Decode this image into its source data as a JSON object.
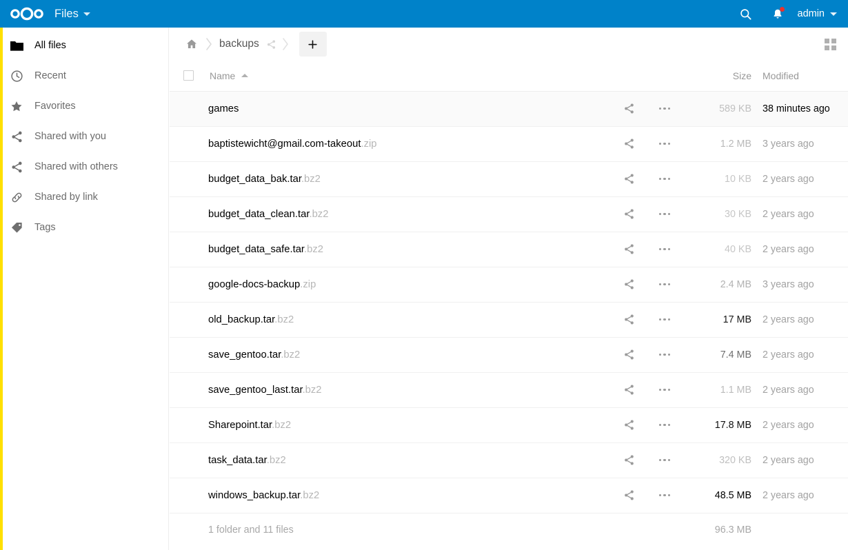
{
  "header": {
    "logo_name": "nextcloud-logo",
    "app_title": "Files",
    "search_icon": "search-icon",
    "notifications_icon": "bell-icon",
    "user_label": "admin"
  },
  "sidebar": {
    "items": [
      {
        "label": "All files",
        "icon": "folder-icon",
        "active": true
      },
      {
        "label": "Recent",
        "icon": "clock-icon",
        "active": false
      },
      {
        "label": "Favorites",
        "icon": "star-icon",
        "active": false
      },
      {
        "label": "Shared with you",
        "icon": "share-icon",
        "active": false
      },
      {
        "label": "Shared with others",
        "icon": "share-icon",
        "active": false
      },
      {
        "label": "Shared by link",
        "icon": "link-icon",
        "active": false
      },
      {
        "label": "Tags",
        "icon": "tag-icon",
        "active": false
      }
    ]
  },
  "controls": {
    "home_icon": "home-icon",
    "breadcrumb": "backups",
    "breadcrumb_share_icon": "share-icon",
    "new_button_label": "+",
    "grid_toggle_icon": "grid-view-icon"
  },
  "table": {
    "columns": {
      "name": "Name",
      "size": "Size",
      "modified": "Modified"
    },
    "sort": "ascending",
    "rows": [
      {
        "basename": "games",
        "ext": "",
        "icon": "folder-icon",
        "size": "589 KB",
        "size_shade": "#c0c0c0",
        "modified": "38 minutes ago",
        "recent": true
      },
      {
        "basename": "baptistewicht@gmail.com-takeout",
        "ext": ".zip",
        "icon": "archive-icon",
        "size": "1.2 MB",
        "size_shade": "#b9b9b9",
        "modified": "3 years ago",
        "recent": false
      },
      {
        "basename": "budget_data_bak.tar",
        "ext": ".bz2",
        "icon": "archive-icon",
        "size": "10 KB",
        "size_shade": "#c6c6c6",
        "modified": "2 years ago",
        "recent": false
      },
      {
        "basename": "budget_data_clean.tar",
        "ext": ".bz2",
        "icon": "archive-icon",
        "size": "30 KB",
        "size_shade": "#c6c6c6",
        "modified": "2 years ago",
        "recent": false
      },
      {
        "basename": "budget_data_safe.tar",
        "ext": ".bz2",
        "icon": "archive-icon",
        "size": "40 KB",
        "size_shade": "#c6c6c6",
        "modified": "2 years ago",
        "recent": false
      },
      {
        "basename": "google-docs-backup",
        "ext": ".zip",
        "icon": "archive-icon",
        "size": "2.4 MB",
        "size_shade": "#b2b2b2",
        "modified": "3 years ago",
        "recent": false
      },
      {
        "basename": "old_backup.tar",
        "ext": ".bz2",
        "icon": "archive-icon",
        "size": "17 MB",
        "size_shade": "#1a1a1a",
        "modified": "2 years ago",
        "recent": false
      },
      {
        "basename": "save_gentoo.tar",
        "ext": ".bz2",
        "icon": "archive-icon",
        "size": "7.4 MB",
        "size_shade": "#6e6e6e",
        "modified": "2 years ago",
        "recent": false
      },
      {
        "basename": "save_gentoo_last.tar",
        "ext": ".bz2",
        "icon": "archive-icon",
        "size": "1.1 MB",
        "size_shade": "#bcbcbc",
        "modified": "2 years ago",
        "recent": false
      },
      {
        "basename": "Sharepoint.tar",
        "ext": ".bz2",
        "icon": "archive-icon",
        "size": "17.8 MB",
        "size_shade": "#111111",
        "modified": "2 years ago",
        "recent": false
      },
      {
        "basename": "task_data.tar",
        "ext": ".bz2",
        "icon": "archive-icon",
        "size": "320 KB",
        "size_shade": "#c0c0c0",
        "modified": "2 years ago",
        "recent": false
      },
      {
        "basename": "windows_backup.tar",
        "ext": ".bz2",
        "icon": "archive-icon",
        "size": "48.5 MB",
        "size_shade": "#000000",
        "modified": "2 years ago",
        "recent": false
      }
    ],
    "summary_text": "1 folder and 11 files",
    "summary_size": "96.3 MB"
  },
  "colors": {
    "brand_blue": "#0082c9",
    "icon_blue": "#0082c9",
    "badge_red": "#e9322d",
    "edge_yellow": "#ffe000"
  }
}
